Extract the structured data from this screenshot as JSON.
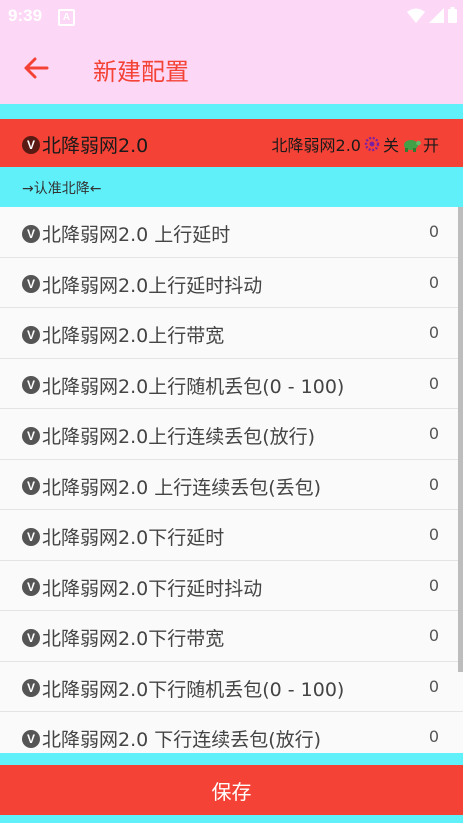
{
  "status": {
    "time": "9:39",
    "notification_letter": "A"
  },
  "appbar": {
    "title": "新建配置"
  },
  "switch_row": {
    "label": "北降弱网2.0",
    "badge": "V",
    "right_name": "北降弱网2.0",
    "off_label": "关",
    "on_label": "开"
  },
  "notice": "→认准北降←",
  "items": [
    {
      "badge": "V",
      "label": "北降弱网2.0 上行延时",
      "value": "0"
    },
    {
      "badge": "V",
      "label": "北降弱网2.0上行延时抖动",
      "value": "0"
    },
    {
      "badge": "V",
      "label": "北降弱网2.0上行带宽",
      "value": "0"
    },
    {
      "badge": "V",
      "label": "北降弱网2.0上行随机丢包(0 - 100)",
      "value": "0"
    },
    {
      "badge": "V",
      "label": "北降弱网2.0上行连续丢包(放行)",
      "value": "0"
    },
    {
      "badge": "V",
      "label": "北降弱网2.0 上行连续丢包(丢包)",
      "value": "0"
    },
    {
      "badge": "V",
      "label": "北降弱网2.0下行延时",
      "value": "0"
    },
    {
      "badge": "V",
      "label": "北降弱网2.0下行延时抖动",
      "value": "0"
    },
    {
      "badge": "V",
      "label": "北降弱网2.0下行带宽",
      "value": "0"
    },
    {
      "badge": "V",
      "label": "北降弱网2.0下行随机丢包(0 - 100)",
      "value": "0"
    },
    {
      "badge": "V",
      "label": "北降弱网2.0 下行连续丢包(放行)",
      "value": "0"
    }
  ],
  "save_label": "保存",
  "colors": {
    "accent": "#F44336",
    "cyan": "#5FF0FA",
    "pink": "#FDD7F6"
  }
}
